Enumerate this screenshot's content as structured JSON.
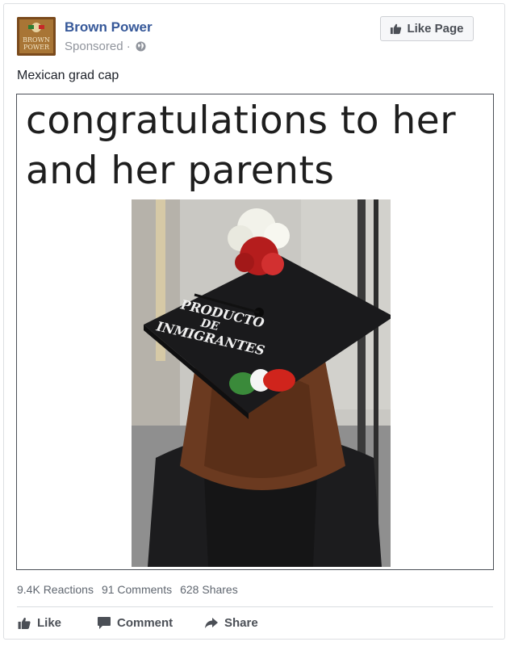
{
  "post": {
    "page_name": "Brown Power",
    "avatar_text": [
      "BROWN",
      "POWER"
    ],
    "sponsored_label": "Sponsored ·",
    "like_page_label": "Like Page",
    "caption": "Mexican grad cap"
  },
  "media": {
    "overlay_line1": "congratulations to her",
    "overlay_line2": "and her parents",
    "cap_text": [
      "PRODUCTO",
      "DE",
      "INMIGRANTES"
    ]
  },
  "stats": {
    "reactions": "9.4K Reactions",
    "comments": "91 Comments",
    "shares": "628 Shares"
  },
  "actions": {
    "like_label": "Like",
    "comment_label": "Comment",
    "share_label": "Share"
  },
  "colors": {
    "page_name": "#365899",
    "meta": "#90949c",
    "flag_green": "#3a8a3a",
    "flag_red": "#d0241c"
  }
}
